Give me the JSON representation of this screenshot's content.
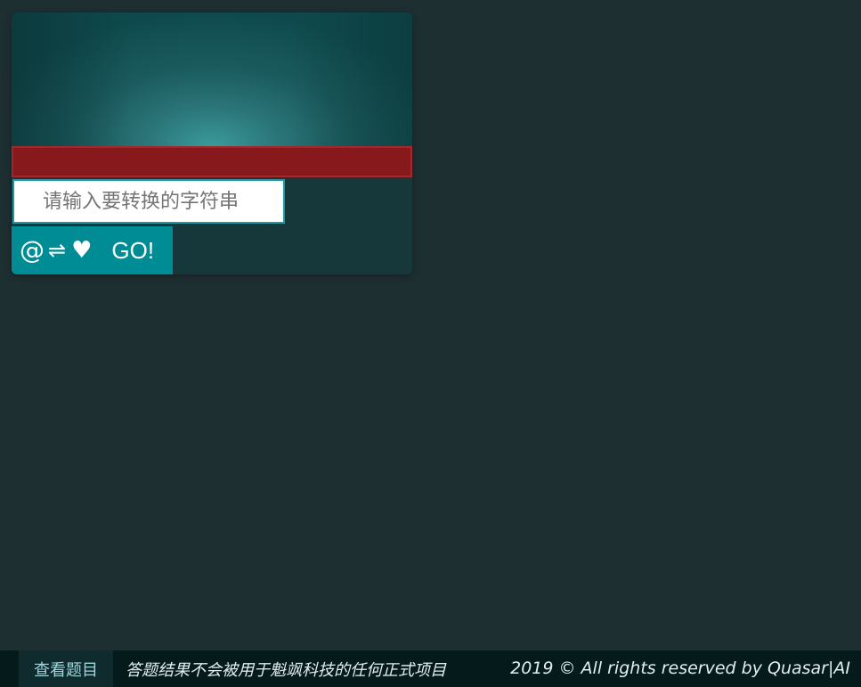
{
  "converter": {
    "input": {
      "value": "",
      "placeholder": "请输入要转换的字符串"
    },
    "toolbar": {
      "at_symbol": "@",
      "swap_symbol": "⇌",
      "heart_symbol": "♥",
      "go_label": "GO!"
    },
    "colors": {
      "accent": "#008c95",
      "red_bar": "#87181b",
      "background": "#1e2f32"
    }
  },
  "footer": {
    "tab_label": "查看题目",
    "note": "答题结果不会被用于魁飒科技的任何正式项目",
    "copyright": "2019 © All rights reserved by Quasar|AI"
  }
}
